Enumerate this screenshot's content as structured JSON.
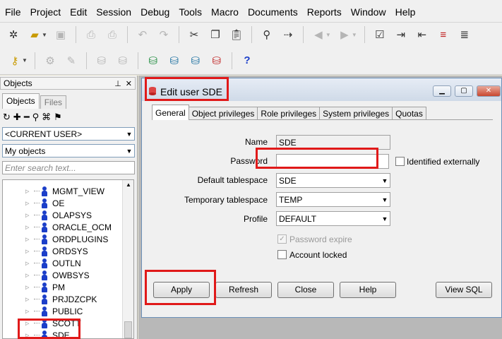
{
  "menu": [
    "File",
    "Project",
    "Edit",
    "Session",
    "Debug",
    "Tools",
    "Macro",
    "Documents",
    "Reports",
    "Window",
    "Help"
  ],
  "toolbar": {
    "icons": [
      "new-icon",
      "open-icon",
      "save-icon",
      "print-icon",
      "print-preview-icon",
      "undo-icon",
      "redo-icon",
      "cut-icon",
      "copy-icon",
      "paste-icon",
      "find-icon",
      "find-next-icon",
      "back-icon",
      "forward-icon",
      "report-icon",
      "indent-icon",
      "unindent-icon",
      "comment-icon",
      "uncomment-icon"
    ],
    "icons2": [
      "key-icon",
      "settings-icon",
      "brush-icon",
      "db-up-icon",
      "db-down-icon",
      "db-connect-icon",
      "sql-db-icon",
      "db-export-icon",
      "db-import-icon",
      "help-icon"
    ],
    "help_glyph": "?"
  },
  "objects_panel": {
    "title": "Objects",
    "tabs": [
      "Objects",
      "Files"
    ],
    "user_combo": "<CURRENT USER>",
    "filter_combo": "My objects",
    "search_placeholder": "Enter search text...",
    "tree_items": [
      "MGMT_VIEW",
      "OE",
      "OLAPSYS",
      "ORACLE_OCM",
      "ORDPLUGINS",
      "ORDSYS",
      "OUTLN",
      "OWBSYS",
      "PM",
      "PRJDZCPK",
      "PUBLIC",
      "SCOTT",
      "SDE"
    ]
  },
  "dialog": {
    "title": "Edit user SDE",
    "tabs": [
      "General",
      "Object privileges",
      "Role privileges",
      "System privileges",
      "Quotas"
    ],
    "fields": {
      "name_label": "Name",
      "name_value": "SDE",
      "password_label": "Password",
      "password_value": "",
      "identified_externally": "Identified externally",
      "default_ts_label": "Default tablespace",
      "default_ts_value": "SDE",
      "temp_ts_label": "Temporary tablespace",
      "temp_ts_value": "TEMP",
      "profile_label": "Profile",
      "profile_value": "DEFAULT",
      "password_expire": "Password expire",
      "account_locked": "Account locked"
    },
    "buttons": {
      "apply": "Apply",
      "refresh": "Refresh",
      "close": "Close",
      "help": "Help",
      "view_sql": "View SQL"
    }
  }
}
